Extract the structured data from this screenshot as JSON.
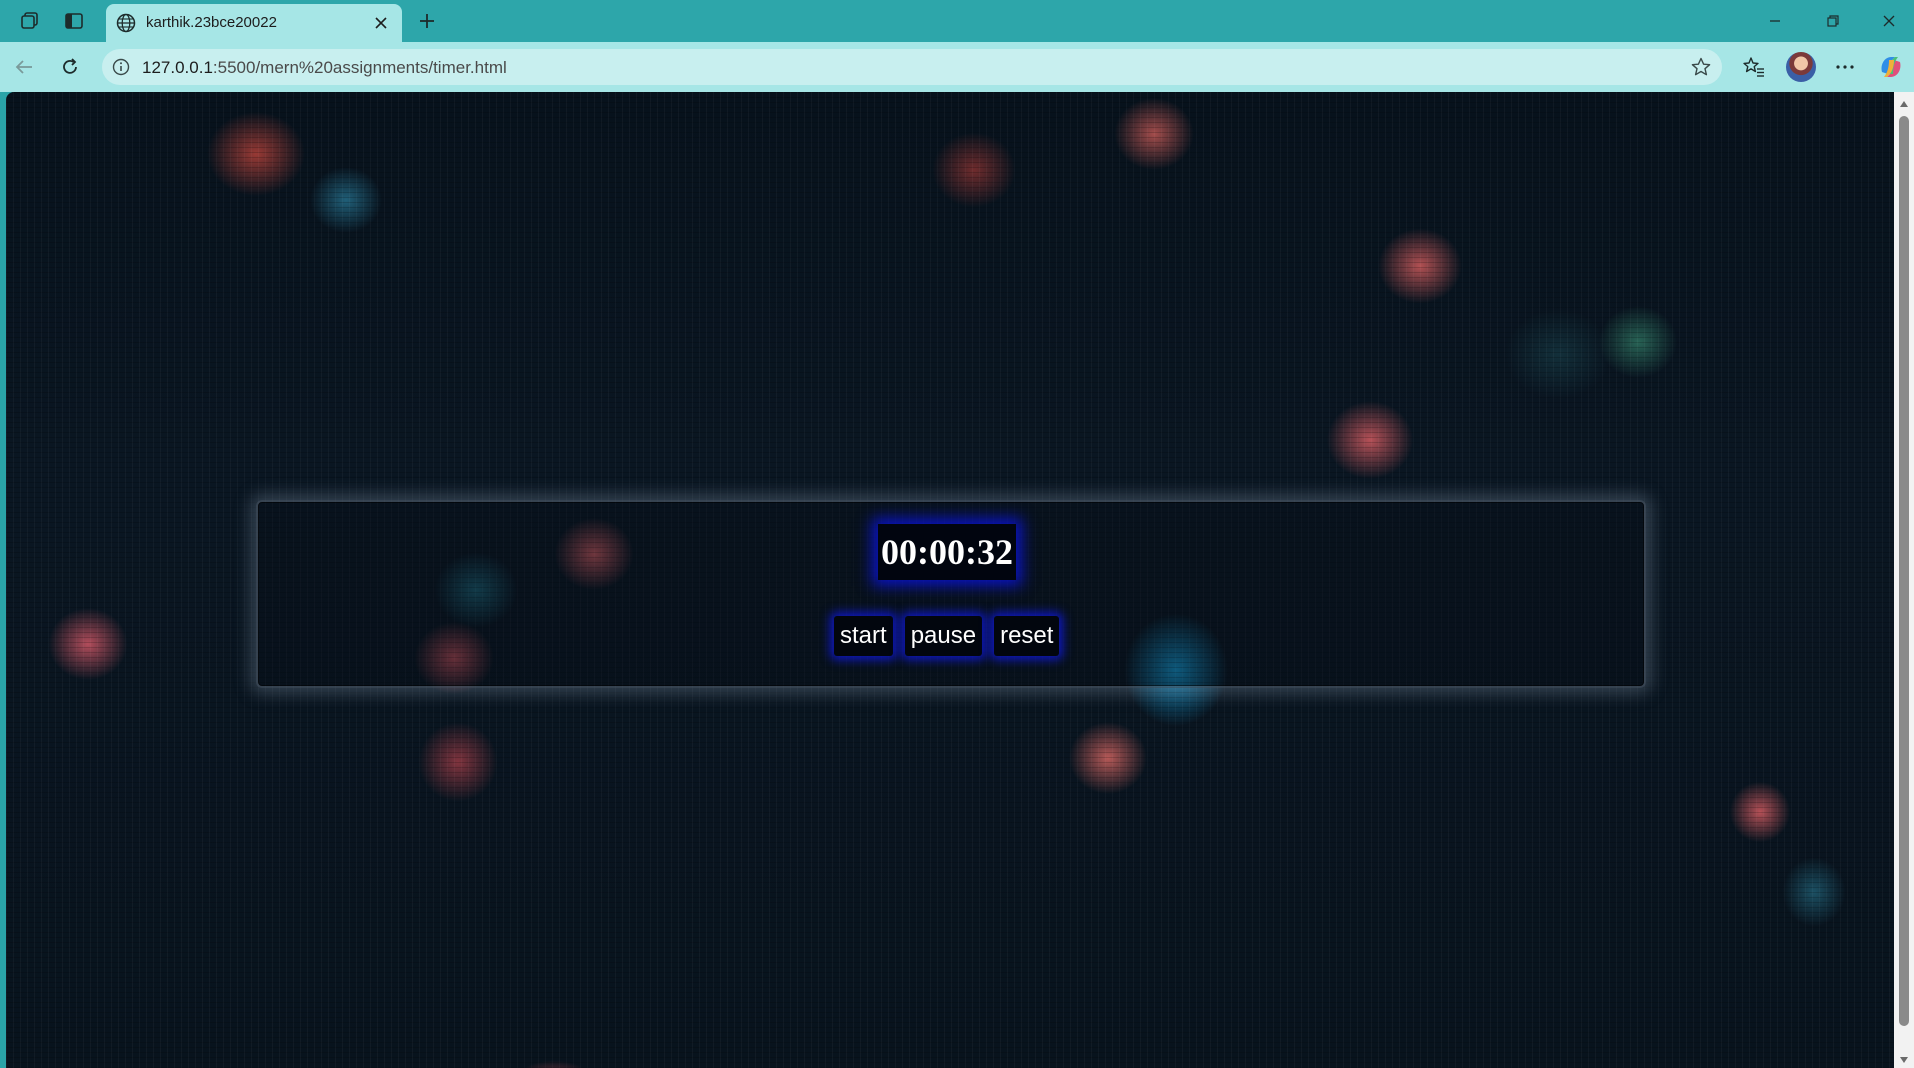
{
  "browser": {
    "tab": {
      "title": "karthik.23bce20022",
      "favicon": "globe-icon"
    },
    "address_bar": {
      "url_host": "127.0.0.1",
      "url_path": ":5500/mern%20assignments/timer.html"
    },
    "icons": {
      "workspaces": "workspaces-icon",
      "vertical_tabs": "vertical-tabs-icon",
      "close_tab": "close-icon",
      "new_tab": "plus-icon",
      "minimize": "minimize-icon",
      "restore": "restore-icon",
      "close_window": "close-icon",
      "back": "back-arrow-icon",
      "refresh": "refresh-icon",
      "site_info": "info-icon",
      "favorite": "star-icon",
      "favorites": "favorites-icon",
      "profile": "avatar",
      "more": "more-icon",
      "copilot": "copilot-icon"
    },
    "colors": {
      "frame": "#2da6aa",
      "toolbar": "#a6e6e6"
    }
  },
  "timer": {
    "display": "00:00:32",
    "buttons": {
      "start": "start",
      "pause": "pause",
      "reset": "reset"
    },
    "colors": {
      "glow": "#0a14dc",
      "text": "#ffffff",
      "button_bg": "#02060e"
    }
  }
}
